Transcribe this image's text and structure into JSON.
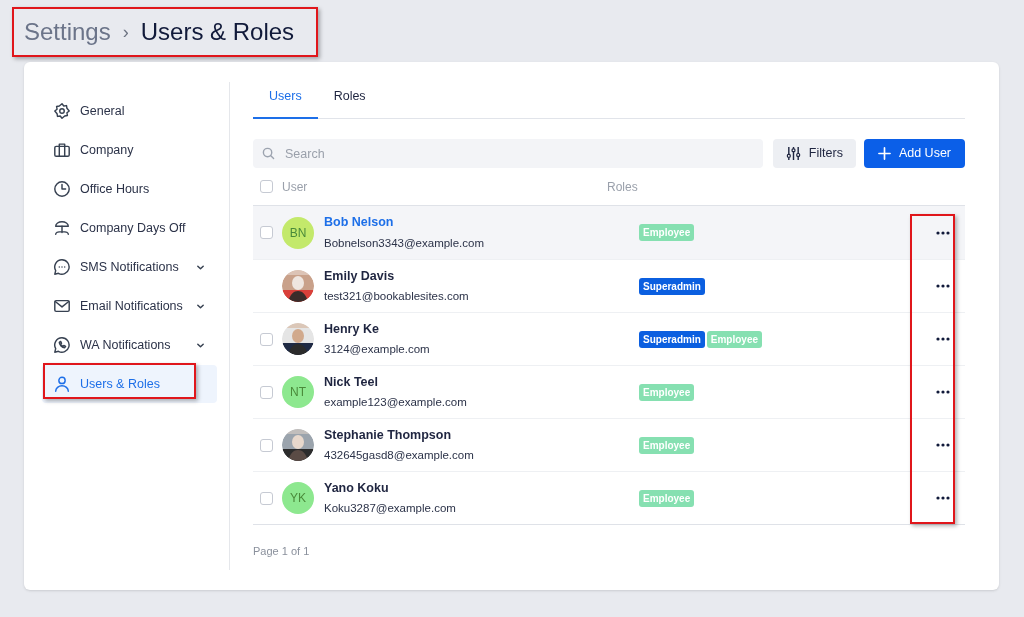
{
  "breadcrumb": {
    "items": [
      "Settings",
      "Users & Roles"
    ],
    "separator": "›",
    "highlighted": true
  },
  "sidebar": {
    "items": [
      {
        "label": "General",
        "expandable": false,
        "selected": false,
        "highlighted": false
      },
      {
        "label": "Company",
        "expandable": false,
        "selected": false,
        "highlighted": false
      },
      {
        "label": "Office Hours",
        "expandable": false,
        "selected": false,
        "highlighted": false
      },
      {
        "label": "Company Days Off",
        "expandable": false,
        "selected": false,
        "highlighted": false
      },
      {
        "label": "SMS Notifications",
        "expandable": true,
        "selected": false,
        "highlighted": false
      },
      {
        "label": "Email Notifications",
        "expandable": true,
        "selected": false,
        "highlighted": false
      },
      {
        "label": "WA Notifications",
        "expandable": true,
        "selected": false,
        "highlighted": false
      },
      {
        "label": "Users & Roles",
        "expandable": false,
        "selected": true,
        "highlighted": true
      }
    ]
  },
  "tabs": [
    {
      "label": "Users",
      "selected": true
    },
    {
      "label": "Roles",
      "selected": false
    }
  ],
  "search": {
    "placeholder": "Search"
  },
  "buttons": [
    {
      "label": "Filters",
      "kind": "secondary"
    },
    {
      "label": "Add User",
      "kind": "primary"
    }
  ],
  "table": {
    "columns": [
      "User",
      "Roles"
    ],
    "all_checked": false,
    "actions_highlighted": true,
    "rows": [
      {
        "name": "Bob Nelson",
        "email": "Bobnelson3343@example.com",
        "avatar": {
          "kind": "initials",
          "initials": "BN",
          "color": "#c3e96b"
        },
        "roles": [
          {
            "label": "Employee",
            "color": "#86e0b1"
          }
        ],
        "checkbox": true,
        "checked": false,
        "hovered": true
      },
      {
        "name": "Emily Davis",
        "email": "test321@bookablesites.com",
        "avatar": {
          "kind": "picture"
        },
        "roles": [
          {
            "label": "Superadmin",
            "color": "#0b5fe0"
          }
        ],
        "checkbox": false,
        "hovered": false
      },
      {
        "name": "Henry Ke",
        "email": "3124@example.com",
        "avatar": {
          "kind": "picture"
        },
        "roles": [
          {
            "label": "Superadmin",
            "color": "#0b5fe0"
          },
          {
            "label": "Employee",
            "color": "#86e0b1"
          }
        ],
        "checkbox": true,
        "checked": false,
        "hovered": false
      },
      {
        "name": "Nick Teel",
        "email": "example123@example.com",
        "avatar": {
          "kind": "initials",
          "initials": "NT",
          "color": "#8de88f"
        },
        "roles": [
          {
            "label": "Employee",
            "color": "#86e0b1"
          }
        ],
        "checkbox": true,
        "checked": false,
        "hovered": false
      },
      {
        "name": "Stephanie Thompson",
        "email": "432645gasd8@example.com",
        "avatar": {
          "kind": "picture"
        },
        "roles": [
          {
            "label": "Employee",
            "color": "#86e0b1"
          }
        ],
        "checkbox": true,
        "checked": false,
        "hovered": false
      },
      {
        "name": "Yano Koku",
        "email": "Koku3287@example.com",
        "avatar": {
          "kind": "initials",
          "initials": "YK",
          "color": "#8de88f"
        },
        "roles": [
          {
            "label": "Employee",
            "color": "#86e0b1"
          }
        ],
        "checkbox": true,
        "checked": false,
        "hovered": false
      }
    ]
  },
  "pagination": "Page 1 of 1"
}
